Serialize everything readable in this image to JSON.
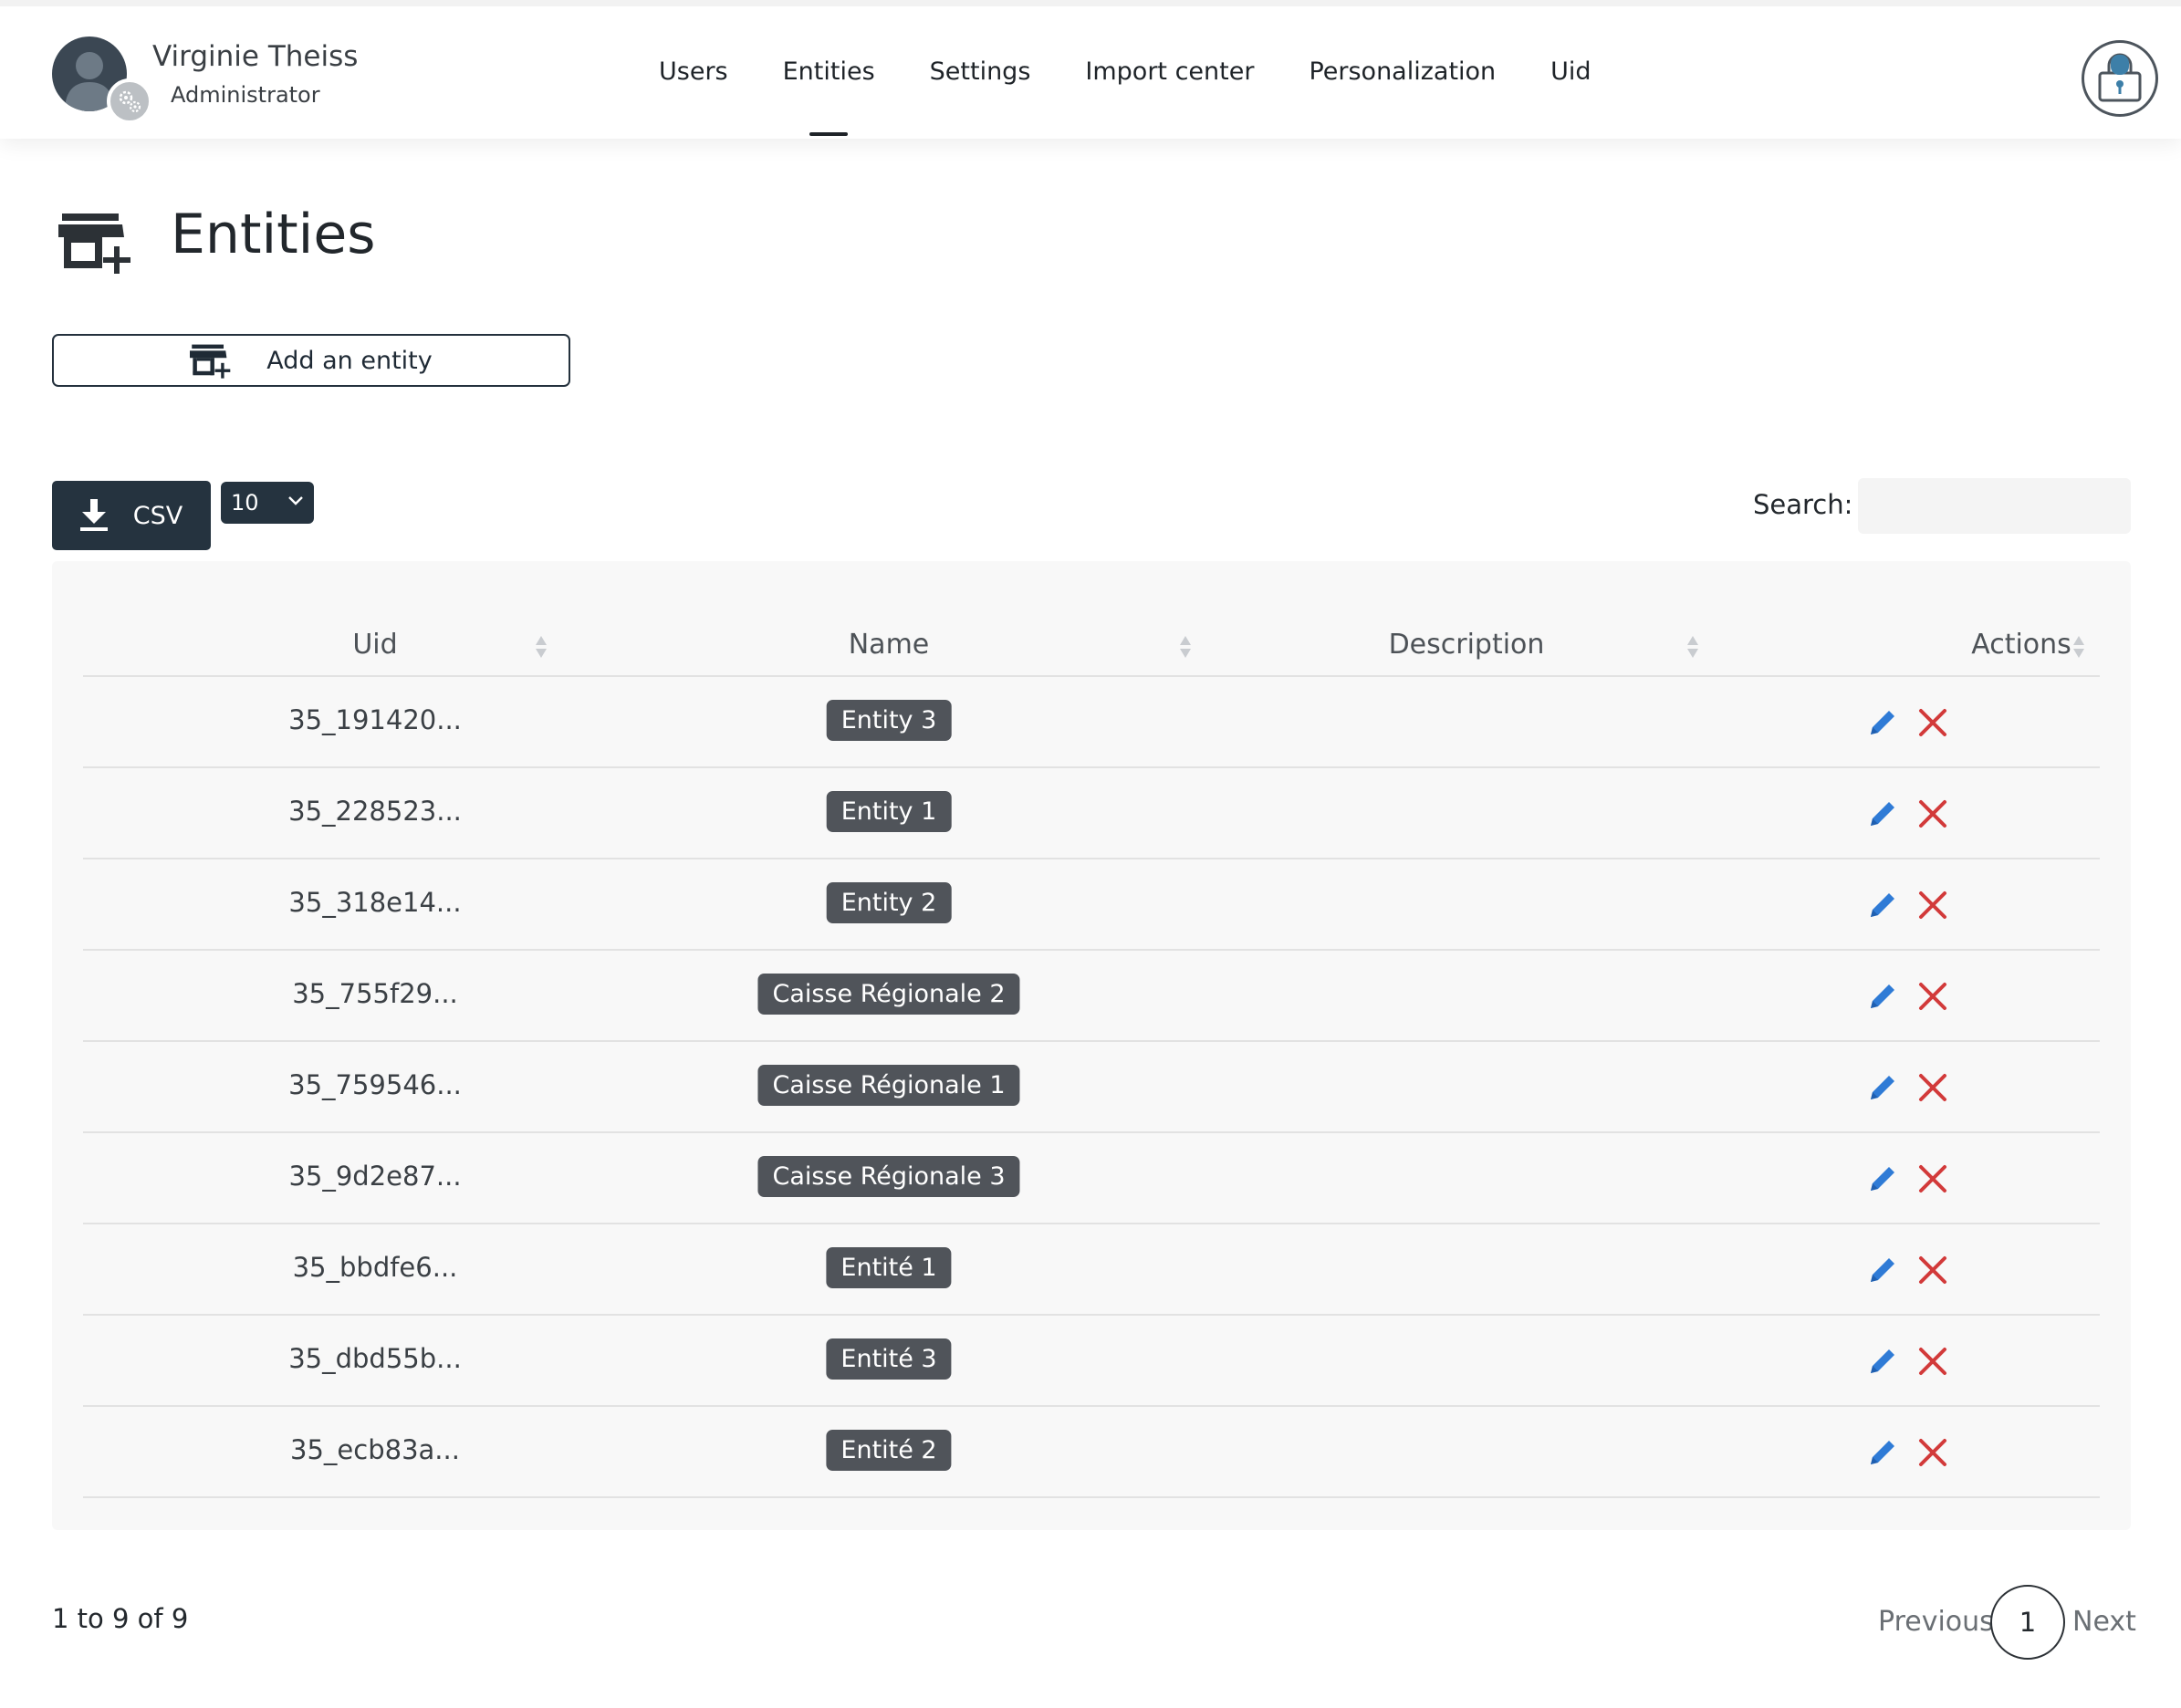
{
  "user": {
    "name": "Virginie Theiss",
    "role": "Administrator"
  },
  "nav": [
    {
      "label": "Users",
      "active": false
    },
    {
      "label": "Entities",
      "active": true
    },
    {
      "label": "Settings",
      "active": false
    },
    {
      "label": "Import center",
      "active": false
    },
    {
      "label": "Personalization",
      "active": false
    },
    {
      "label": "Uid",
      "active": false
    }
  ],
  "page": {
    "title": "Entities",
    "add_label": "Add an entity"
  },
  "controls": {
    "csv_label": "CSV",
    "page_length": "10",
    "search_label": "Search:",
    "search_value": ""
  },
  "table": {
    "columns": [
      "Uid",
      "Name",
      "Description",
      "Actions"
    ],
    "rows": [
      {
        "uid": "35_191420...",
        "name": "Entity 3",
        "description": ""
      },
      {
        "uid": "35_228523...",
        "name": "Entity 1",
        "description": ""
      },
      {
        "uid": "35_318e14...",
        "name": "Entity 2",
        "description": ""
      },
      {
        "uid": "35_755f29...",
        "name": "Caisse Régionale 2",
        "description": ""
      },
      {
        "uid": "35_759546...",
        "name": "Caisse Régionale 1",
        "description": ""
      },
      {
        "uid": "35_9d2e87...",
        "name": "Caisse Régionale 3",
        "description": ""
      },
      {
        "uid": "35_bbdfe6...",
        "name": "Entité 1",
        "description": ""
      },
      {
        "uid": "35_dbd55b...",
        "name": "Entité 3",
        "description": ""
      },
      {
        "uid": "35_ecb83a...",
        "name": "Entité 2",
        "description": ""
      }
    ]
  },
  "footer": {
    "info": "1 to 9 of 9",
    "previous": "Previous",
    "page": "1",
    "next": "Next"
  },
  "colors": {
    "dark": "#25333f",
    "badge": "#50545a",
    "edit": "#2f7bd6",
    "delete": "#d23a3a"
  },
  "icons": {
    "edit": "pencil-icon",
    "delete": "close-icon",
    "sort": "sort-icon",
    "download": "download-icon",
    "store": "store-add-icon",
    "lock": "lock-icon"
  }
}
